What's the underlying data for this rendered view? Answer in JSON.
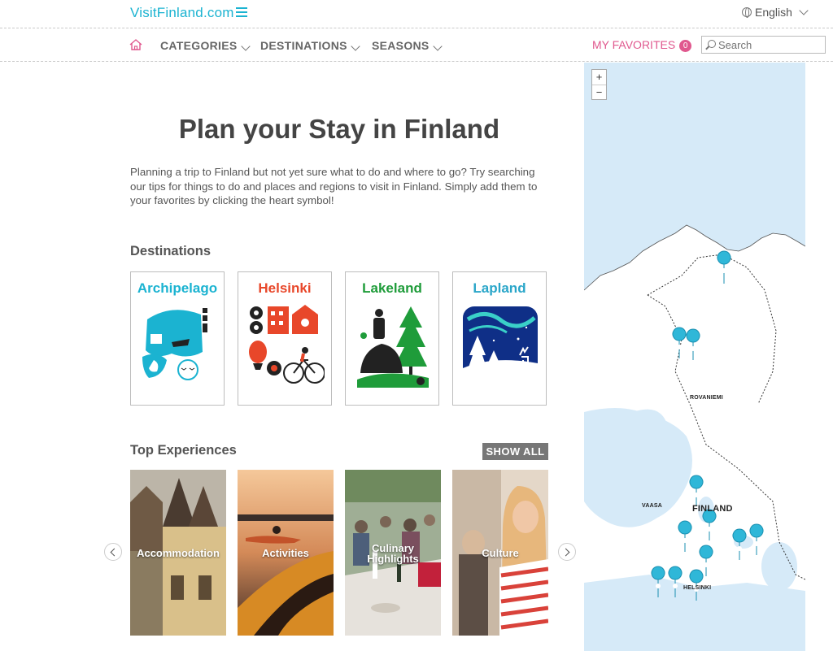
{
  "header": {
    "logo": "VisitFinland.com",
    "language": "English"
  },
  "nav": {
    "categories": "CATEGORIES",
    "destinations": "DESTINATIONS",
    "seasons": "SEASONS",
    "favorites_label": "MY FAVORITES",
    "favorites_count": "0",
    "search_placeholder": "Search"
  },
  "main": {
    "title": "Plan your Stay in Finland",
    "intro": "Planning a trip to Finland but not yet sure what to do and where to go? Try searching our tips for things to do and places and regions to visit in Finland. Simply add them to your favorites by clicking the heart symbol!",
    "destinations_heading": "Destinations",
    "destinations": [
      {
        "name": "Archipelago",
        "color": "#1bb3d1"
      },
      {
        "name": "Helsinki",
        "color": "#e8472a"
      },
      {
        "name": "Lakeland",
        "color": "#1f9c3a"
      },
      {
        "name": "Lapland",
        "color": "#2aa6c9"
      }
    ],
    "experiences_heading": "Top Experiences",
    "show_all": "SHOW ALL",
    "experiences": [
      {
        "label": "Accommodation"
      },
      {
        "label": "Activities"
      },
      {
        "label": "Culinary Highlights"
      },
      {
        "label": "Culture"
      }
    ]
  },
  "map": {
    "zoom_in": "+",
    "zoom_out": "−",
    "labels": {
      "rovaniemi": "ROVANIEMI",
      "finland": "FINLAND",
      "vaasa": "VAASA",
      "helsinki": "HELSINKI"
    }
  },
  "colors": {
    "brand": "#1bb3d1",
    "favorites": "#e0588e",
    "map_water": "#d6eaf8",
    "map_pin": "#2fb7d8"
  }
}
